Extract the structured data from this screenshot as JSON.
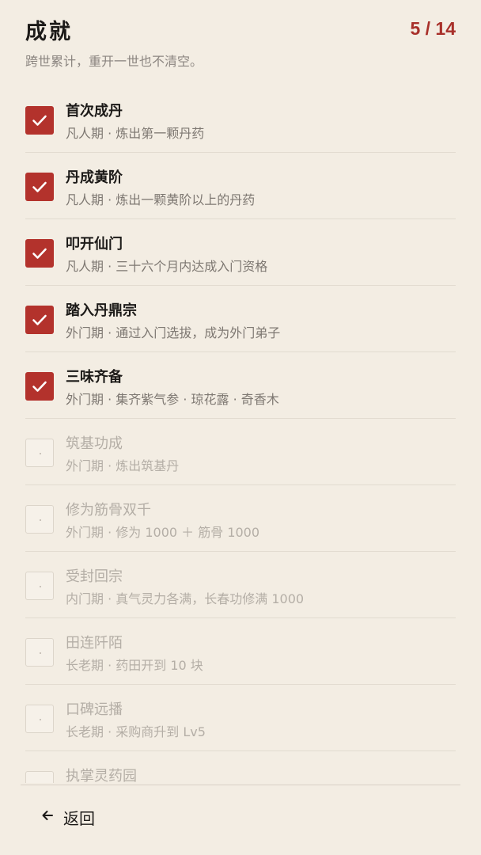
{
  "header": {
    "title": "成就",
    "progress": "5 / 14",
    "subtitle": "跨世累计，重开一世也不清空。"
  },
  "colors": {
    "accent": "#b3322c",
    "progress": "#a8302a",
    "background": "#f3ede3"
  },
  "achievements": [
    {
      "name": "首次成丹",
      "desc": "凡人期 · 炼出第一颗丹药",
      "done": true
    },
    {
      "name": "丹成黄阶",
      "desc": "凡人期 · 炼出一颗黄阶以上的丹药",
      "done": true
    },
    {
      "name": "叩开仙门",
      "desc": "凡人期 · 三十六个月内达成入门资格",
      "done": true
    },
    {
      "name": "踏入丹鼎宗",
      "desc": "外门期 · 通过入门选拔，成为外门弟子",
      "done": true
    },
    {
      "name": "三味齐备",
      "desc": "外门期 · 集齐紫气参 · 琼花露 · 奇香木",
      "done": true
    },
    {
      "name": "筑基功成",
      "desc": "外门期 · 炼出筑基丹",
      "done": false
    },
    {
      "name": "修为筋骨双千",
      "desc": "外门期 · 修为 1000 ＋ 筋骨 1000",
      "done": false
    },
    {
      "name": "受封回宗",
      "desc": "内门期 · 真气灵力各满，长春功修满 1000",
      "done": false
    },
    {
      "name": "田连阡陌",
      "desc": "长老期 · 药田开到 10 块",
      "done": false
    },
    {
      "name": "口碑远播",
      "desc": "长老期 · 采购商升到 Lv5",
      "done": false
    },
    {
      "name": "执掌灵药园",
      "desc": "",
      "done": false
    }
  ],
  "footer": {
    "back_label": "返回",
    "back_icon": "arrow-left-icon"
  }
}
